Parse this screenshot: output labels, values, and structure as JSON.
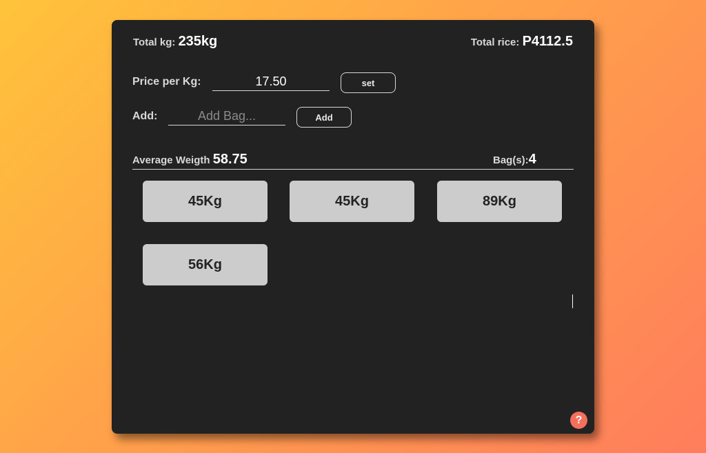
{
  "summary": {
    "total_kg_label": "Total kg:",
    "total_kg_value": "235kg",
    "total_price_label": "Total rice:",
    "total_price_value": "P4112.5"
  },
  "price_row": {
    "label": "Price per Kg:",
    "value": "17.50",
    "button_label": "set"
  },
  "add_row": {
    "label": "Add:",
    "placeholder": "Add Bag...",
    "value": "",
    "button_label": "Add"
  },
  "stats": {
    "average_label": "Average Weigth",
    "average_value": "58.75",
    "bags_label": "Bag(s):",
    "bags_value": "4"
  },
  "bags": [
    {
      "label": "45Kg"
    },
    {
      "label": "45Kg"
    },
    {
      "label": "89Kg"
    },
    {
      "label": "56Kg"
    }
  ],
  "help_icon": {
    "glyph": "?",
    "icon": "help-icon",
    "color": "#f46f5c"
  },
  "colors": {
    "card_background": "#222222",
    "bag_background": "#cccccc",
    "gradient_start": "#ffc33a",
    "gradient_end": "#ff7d5c"
  }
}
